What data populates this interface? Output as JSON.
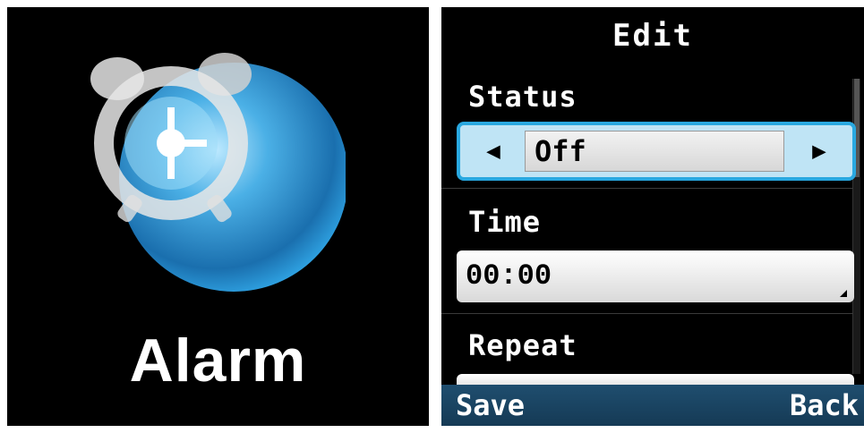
{
  "app_screen": {
    "app_name": "Alarm",
    "icon": "alarm-clock-icon",
    "colors": {
      "bubble": "#1e86c7",
      "bubble_light": "#7fd0f5",
      "background": "#000000"
    }
  },
  "edit_screen": {
    "title": "Edit",
    "status": {
      "label": "Status",
      "value": "Off",
      "prev_icon": "left-arrow-icon",
      "next_icon": "right-arrow-icon"
    },
    "time": {
      "label": "Time",
      "value": "00:00"
    },
    "repeat": {
      "label": "Repeat"
    },
    "softkeys": {
      "left": "Save",
      "right": "Back"
    },
    "colors": {
      "accent": "#29a8e0",
      "softkey_bar": "#1f4e6f"
    }
  }
}
